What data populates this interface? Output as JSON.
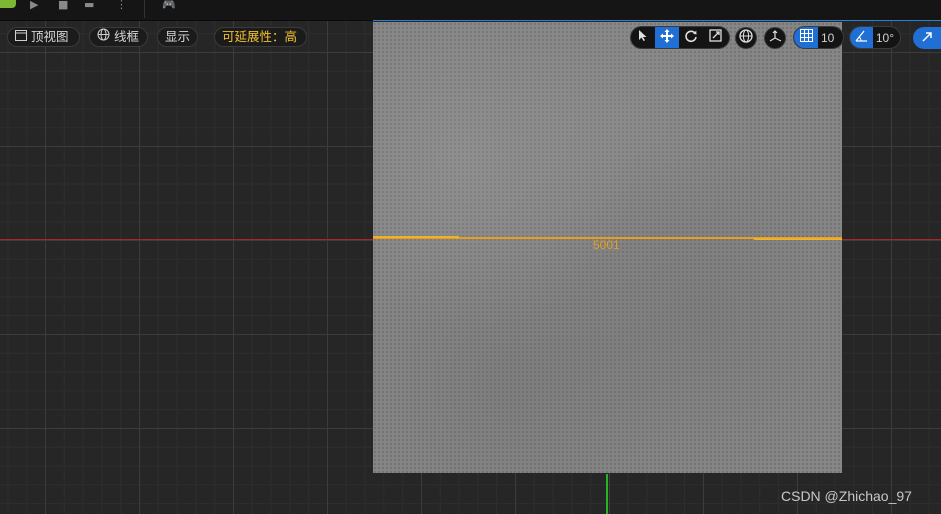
{
  "viewport_toolbar": {
    "view_mode_label": "顶视图",
    "view_mode_icon": "viewport-icon",
    "render_mode_label": "线框",
    "render_mode_icon": "wireframe-globe-icon",
    "show_label": "显示",
    "scalability_label": "可延展性：高"
  },
  "transform_tools": {
    "select_icon": "cursor-icon",
    "translate_icon": "move-icon",
    "rotate_icon": "rotate-icon",
    "scale_icon": "scale-icon",
    "active_tool": "translate"
  },
  "snapping": {
    "grid_snap_value": "10",
    "rotation_snap_value": "10°"
  },
  "measurement": {
    "value": "5001"
  },
  "watermark": "CSDN @Zhichao_97",
  "colors": {
    "accent_blue": "#1f6fd4",
    "measure_orange": "#e3a021",
    "x_axis_red": "#b02323",
    "y_axis_green": "#25b425",
    "scalability_yellow": "#f2c12e"
  }
}
